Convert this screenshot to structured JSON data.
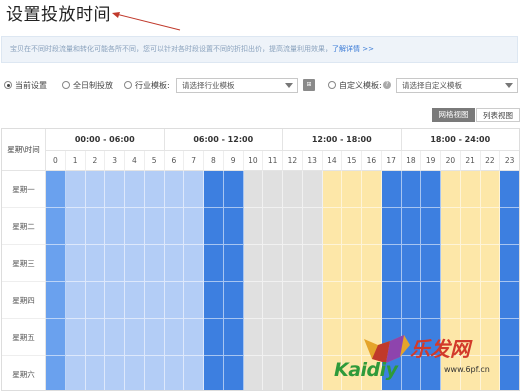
{
  "page": {
    "title": "设置投放时间"
  },
  "tip": {
    "text": "宝贝在不同时段流量和转化可能各所不同，您可以针对各时段设置不同的折扣出价，提高流量利用效果，",
    "link": "了解详情 >>"
  },
  "settings": {
    "current": "当前设置",
    "all_day": "全日制投放",
    "industry": "行业模板:",
    "industry_placeholder": "请选择行业模板",
    "custom": "自定义模板:",
    "custom_placeholder": "请选择自定义模板",
    "small_btn_glyph": "⊞",
    "help_glyph": "?"
  },
  "view": {
    "grid": "网格视图",
    "list": "列表视图"
  },
  "schedule": {
    "corner_label": "星期\\时间",
    "ranges": [
      "00:00 - 06:00",
      "06:00 - 12:00",
      "12:00 - 18:00",
      "18:00 - 24:00"
    ],
    "hours": [
      "0",
      "1",
      "2",
      "3",
      "4",
      "5",
      "6",
      "7",
      "8",
      "9",
      "10",
      "11",
      "12",
      "13",
      "14",
      "15",
      "16",
      "17",
      "18",
      "19",
      "20",
      "21",
      "22",
      "23"
    ],
    "days": [
      "星期一",
      "星期二",
      "星期三",
      "星期四",
      "星期五",
      "星期六"
    ],
    "hour_levels": [
      "light",
      "light",
      "light",
      "light",
      "light",
      "light",
      "light",
      "light",
      "dark",
      "dark",
      "gray",
      "gray",
      "gray",
      "gray",
      "yellow",
      "yellow",
      "yellow",
      "dark",
      "dark",
      "dark",
      "yellow",
      "yellow",
      "yellow",
      "dark"
    ],
    "colors": {
      "light": "#b3cdf6",
      "dark": "#3d7fe0",
      "gray": "#e0e0e0",
      "yellow": "#fde7a8",
      "lead": "#6aa1ee"
    }
  },
  "watermark": {
    "brand_cn": "乐发网",
    "brand_en": "Kaidiy",
    "url": "www.6pf.cn"
  }
}
